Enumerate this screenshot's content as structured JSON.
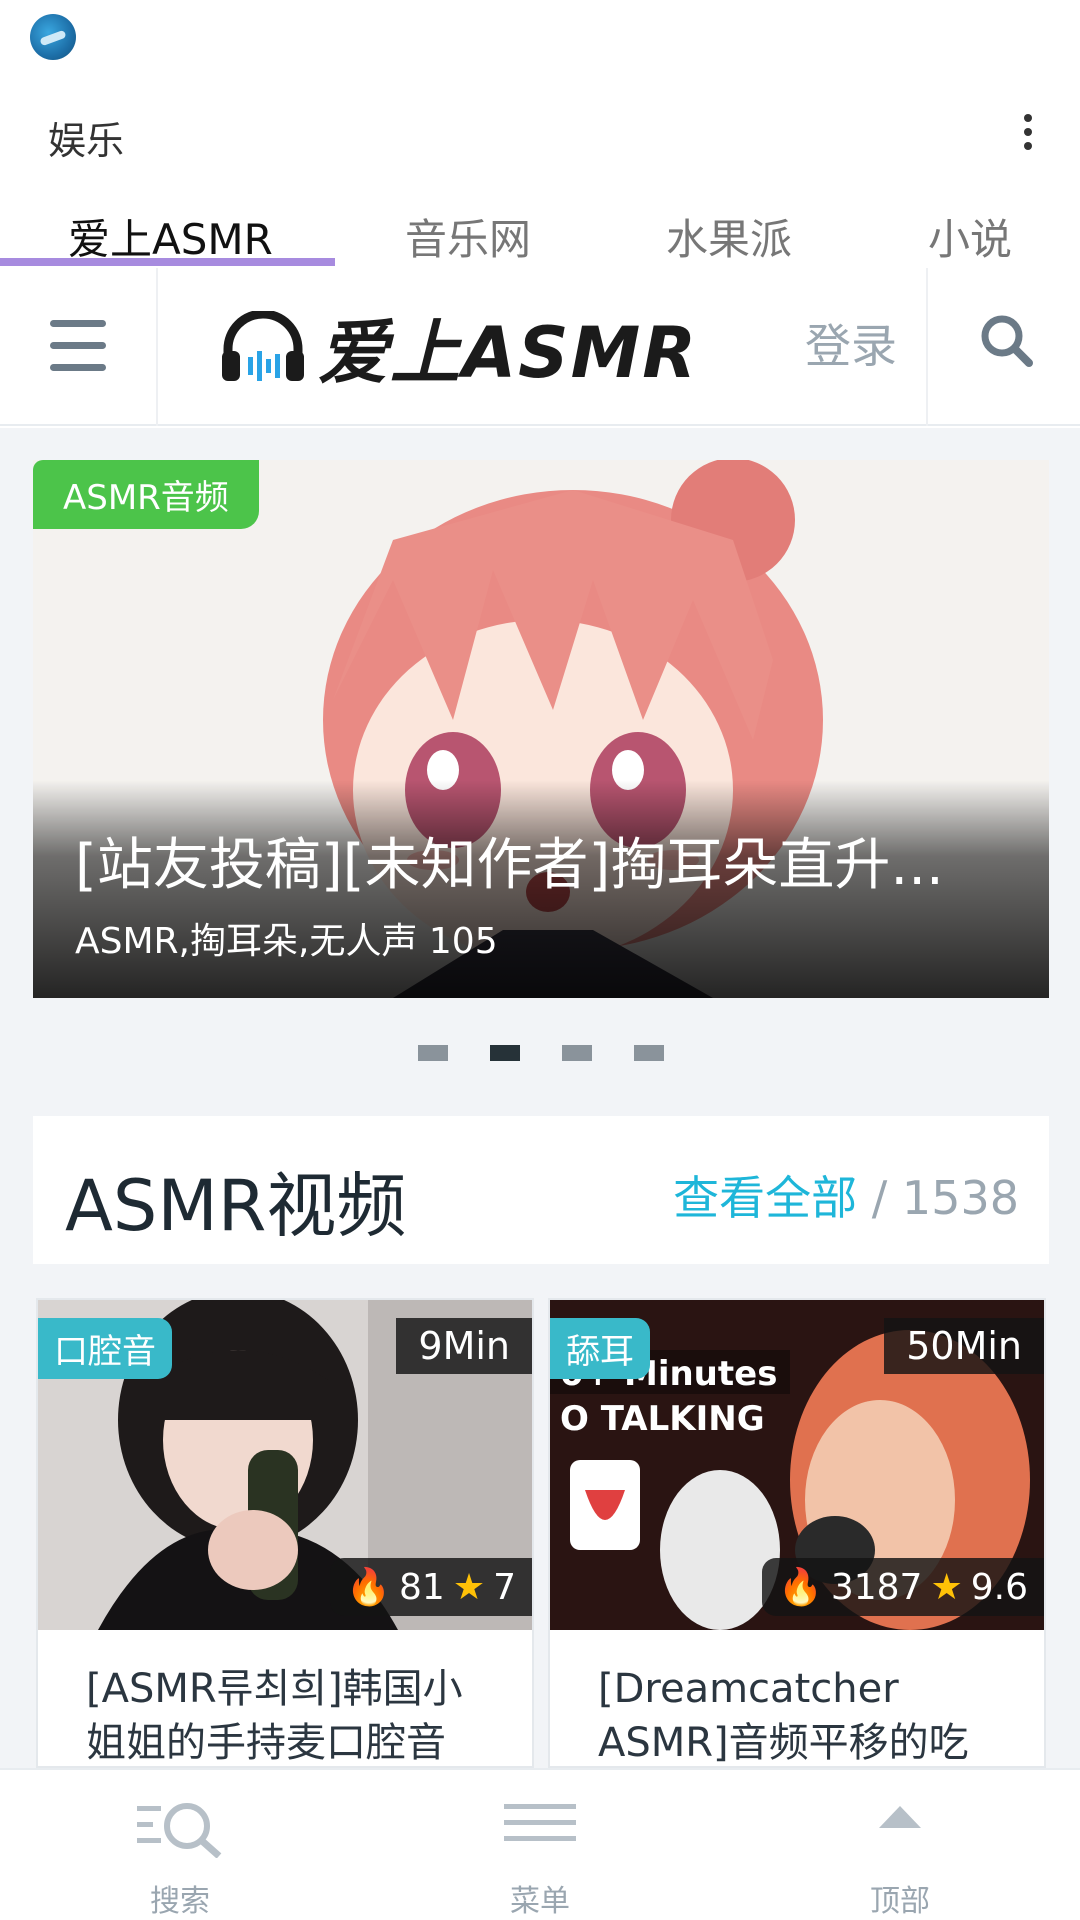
{
  "app": {
    "title": "娱乐"
  },
  "tabs": [
    {
      "label": "爱上ASMR",
      "active": true
    },
    {
      "label": "音乐网",
      "active": false
    },
    {
      "label": "水果派",
      "active": false
    },
    {
      "label": "小说",
      "active": false
    }
  ],
  "header": {
    "logo_text": "爱上ASMR",
    "login_label": "登录"
  },
  "slider": {
    "badge": "ASMR音频",
    "title": "[站友投稿][未知作者]掏耳朵直升...",
    "meta": "ASMR,掏耳朵,无人声 105",
    "dots_total": 4,
    "active_dot": 2
  },
  "section": {
    "title": "ASMR视频",
    "view_all": "查看全部",
    "separator": " / ",
    "count": "1538"
  },
  "cards": [
    {
      "tag": "口腔音",
      "duration": "9Min",
      "views": "81",
      "rating": "7",
      "title": "[ASMR류최희]韩国小姐姐的手持麦口腔音"
    },
    {
      "tag": "舔耳",
      "duration": "50Min",
      "views": "3187",
      "rating": "9.6",
      "title": "[Dreamcatcher ASMR]音频平移的吃耳..."
    }
  ],
  "bottom_nav": [
    {
      "label": "搜索",
      "icon": "search-list-icon"
    },
    {
      "label": "菜单",
      "icon": "menu-icon"
    },
    {
      "label": "顶部",
      "icon": "back-to-top-icon"
    }
  ],
  "colors": {
    "tab_indicator": "#a78bdf",
    "slider_badge": "#4cc44a",
    "card_tag": "#39b9c9",
    "link": "#1eb6d9",
    "page_bg": "#f2f4f7"
  }
}
